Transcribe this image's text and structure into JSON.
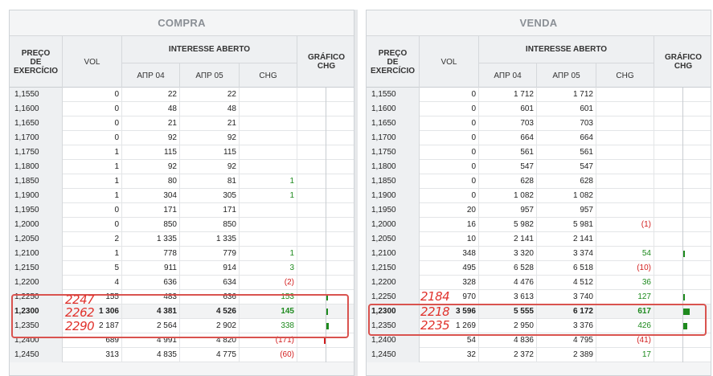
{
  "compra": {
    "title": "COMPRA",
    "header": {
      "preco": [
        "PREÇO",
        "DE",
        "EXERCÍCIO"
      ],
      "vol": "VOL",
      "interesse": "INTERESSE ABERTO",
      "apr04": "АПР 04",
      "apr05": "АПР 05",
      "chg": "CHG",
      "grafico": [
        "GRÁFICO",
        "CHG"
      ]
    },
    "rows": [
      {
        "strike": "1,1550",
        "vol": "0",
        "apr04": "22",
        "apr05": "22",
        "chg": "",
        "dir": "",
        "bar": 0
      },
      {
        "strike": "1,1600",
        "vol": "0",
        "apr04": "48",
        "apr05": "48",
        "chg": "",
        "dir": "",
        "bar": 0
      },
      {
        "strike": "1,1650",
        "vol": "0",
        "apr04": "21",
        "apr05": "21",
        "chg": "",
        "dir": "",
        "bar": 0
      },
      {
        "strike": "1,1700",
        "vol": "0",
        "apr04": "92",
        "apr05": "92",
        "chg": "",
        "dir": "",
        "bar": 0
      },
      {
        "strike": "1,1750",
        "vol": "1",
        "apr04": "115",
        "apr05": "115",
        "chg": "",
        "dir": "",
        "bar": 0
      },
      {
        "strike": "1,1800",
        "vol": "1",
        "apr04": "92",
        "apr05": "92",
        "chg": "",
        "dir": "",
        "bar": 0
      },
      {
        "strike": "1,1850",
        "vol": "1",
        "apr04": "80",
        "apr05": "81",
        "chg": "1",
        "dir": "pos",
        "bar": 0
      },
      {
        "strike": "1,1900",
        "vol": "1",
        "apr04": "304",
        "apr05": "305",
        "chg": "1",
        "dir": "pos",
        "bar": 0
      },
      {
        "strike": "1,1950",
        "vol": "0",
        "apr04": "171",
        "apr05": "171",
        "chg": "",
        "dir": "",
        "bar": 0
      },
      {
        "strike": "1,2000",
        "vol": "0",
        "apr04": "850",
        "apr05": "850",
        "chg": "",
        "dir": "",
        "bar": 0
      },
      {
        "strike": "1,2050",
        "vol": "2",
        "apr04": "1 335",
        "apr05": "1 335",
        "chg": "",
        "dir": "",
        "bar": 0
      },
      {
        "strike": "1,2100",
        "vol": "1",
        "apr04": "778",
        "apr05": "779",
        "chg": "1",
        "dir": "pos",
        "bar": 0
      },
      {
        "strike": "1,2150",
        "vol": "5",
        "apr04": "911",
        "apr05": "914",
        "chg": "3",
        "dir": "pos",
        "bar": 0
      },
      {
        "strike": "1,2200",
        "vol": "4",
        "apr04": "636",
        "apr05": "634",
        "chg": "(2)",
        "dir": "neg",
        "bar": 0
      },
      {
        "strike": "1,2250",
        "vol": "155",
        "apr04": "483",
        "apr05": "636",
        "chg": "153",
        "dir": "pos",
        "bar": 0.04
      },
      {
        "strike": "1,2300",
        "vol": "1 306",
        "apr04": "4 381",
        "apr05": "4 526",
        "chg": "145",
        "dir": "pos",
        "bar": 0.04,
        "bold": true
      },
      {
        "strike": "1,2350",
        "vol": "2 187",
        "apr04": "2 564",
        "apr05": "2 902",
        "chg": "338",
        "dir": "pos",
        "bar": 0.09
      },
      {
        "strike": "1,2400",
        "vol": "689",
        "apr04": "4 991",
        "apr05": "4 820",
        "chg": "(171)",
        "dir": "neg",
        "bar": 0.04
      },
      {
        "strike": "1,2450",
        "vol": "313",
        "apr04": "4 835",
        "apr05": "4 775",
        "chg": "(60)",
        "dir": "neg",
        "bar": 0
      }
    ],
    "annotations": [
      "2247",
      "2262",
      "2290"
    ]
  },
  "venda": {
    "title": "VENDA",
    "header": {
      "preco": [
        "PREÇO",
        "DE",
        "EXERCÍCIO"
      ],
      "vol": "VOL",
      "interesse": "INTERESSE ABERTO",
      "apr04": "АПР 04",
      "apr05": "АПР 05",
      "chg": "CHG",
      "grafico": [
        "GRÁFICO",
        "CHG"
      ]
    },
    "rows": [
      {
        "strike": "1,1550",
        "vol": "0",
        "apr04": "1 712",
        "apr05": "1 712",
        "chg": "",
        "dir": "",
        "bar": 0
      },
      {
        "strike": "1,1600",
        "vol": "0",
        "apr04": "601",
        "apr05": "601",
        "chg": "",
        "dir": "",
        "bar": 0
      },
      {
        "strike": "1,1650",
        "vol": "0",
        "apr04": "703",
        "apr05": "703",
        "chg": "",
        "dir": "",
        "bar": 0
      },
      {
        "strike": "1,1700",
        "vol": "0",
        "apr04": "664",
        "apr05": "664",
        "chg": "",
        "dir": "",
        "bar": 0
      },
      {
        "strike": "1,1750",
        "vol": "0",
        "apr04": "561",
        "apr05": "561",
        "chg": "",
        "dir": "",
        "bar": 0
      },
      {
        "strike": "1,1800",
        "vol": "0",
        "apr04": "547",
        "apr05": "547",
        "chg": "",
        "dir": "",
        "bar": 0
      },
      {
        "strike": "1,1850",
        "vol": "0",
        "apr04": "628",
        "apr05": "628",
        "chg": "",
        "dir": "",
        "bar": 0
      },
      {
        "strike": "1,1900",
        "vol": "0",
        "apr04": "1 082",
        "apr05": "1 082",
        "chg": "",
        "dir": "",
        "bar": 0
      },
      {
        "strike": "1,1950",
        "vol": "20",
        "apr04": "957",
        "apr05": "957",
        "chg": "",
        "dir": "",
        "bar": 0
      },
      {
        "strike": "1,2000",
        "vol": "16",
        "apr04": "5 982",
        "apr05": "5 981",
        "chg": "(1)",
        "dir": "neg",
        "bar": 0
      },
      {
        "strike": "1,2050",
        "vol": "10",
        "apr04": "2 141",
        "apr05": "2 141",
        "chg": "",
        "dir": "",
        "bar": 0
      },
      {
        "strike": "1,2100",
        "vol": "348",
        "apr04": "3 320",
        "apr05": "3 374",
        "chg": "54",
        "dir": "pos",
        "bar": 0.03
      },
      {
        "strike": "1,2150",
        "vol": "495",
        "apr04": "6 528",
        "apr05": "6 518",
        "chg": "(10)",
        "dir": "neg",
        "bar": 0
      },
      {
        "strike": "1,2200",
        "vol": "328",
        "apr04": "4 476",
        "apr05": "4 512",
        "chg": "36",
        "dir": "pos",
        "bar": 0
      },
      {
        "strike": "1,2250",
        "vol": "970",
        "apr04": "3 613",
        "apr05": "3 740",
        "chg": "127",
        "dir": "pos",
        "bar": 0.04
      },
      {
        "strike": "1,2300",
        "vol": "3 596",
        "apr04": "5 555",
        "apr05": "6 172",
        "chg": "617",
        "dir": "pos",
        "bar": 0.22,
        "bold": true
      },
      {
        "strike": "1,2350",
        "vol": "1 269",
        "apr04": "2 950",
        "apr05": "3 376",
        "chg": "426",
        "dir": "pos",
        "bar": 0.15
      },
      {
        "strike": "1,2400",
        "vol": "54",
        "apr04": "4 836",
        "apr05": "4 795",
        "chg": "(41)",
        "dir": "neg",
        "bar": 0
      },
      {
        "strike": "1,2450",
        "vol": "32",
        "apr04": "2 372",
        "apr05": "2 389",
        "chg": "17",
        "dir": "pos",
        "bar": 0
      }
    ],
    "annotations": [
      "2184",
      "2218",
      "2235"
    ]
  },
  "colors": {
    "positive": "#1e8a1e",
    "negative": "#d21e1e",
    "annotation": "#e0322c"
  }
}
